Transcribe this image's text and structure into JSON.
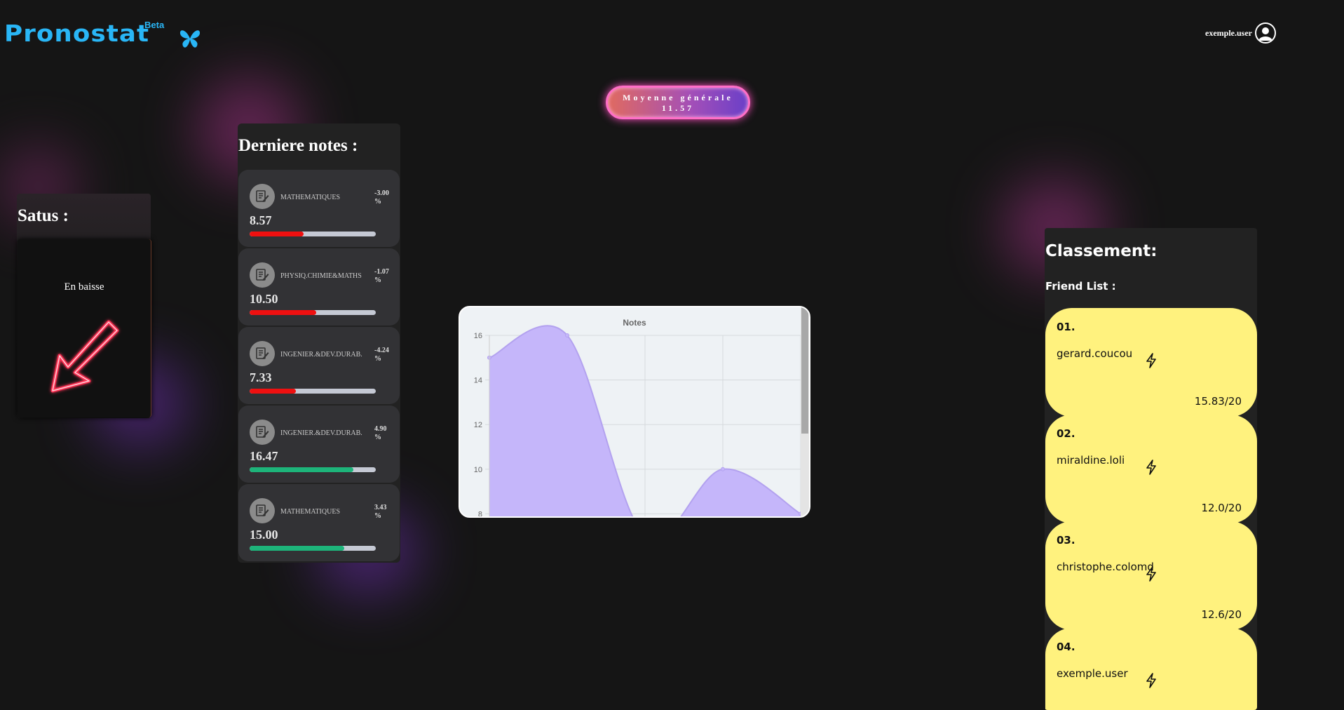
{
  "header": {
    "logo_text": "Pronostat",
    "logo_badge": "Beta",
    "username": "exemple.user"
  },
  "average": {
    "label": "Moyenne générale",
    "value": "11.57"
  },
  "status": {
    "title": "Satus :",
    "label": "En baisse"
  },
  "notes": {
    "title": "Derniere notes :",
    "items": [
      {
        "subject": "MATHEMATIQUES",
        "change": "-3.00",
        "unit": "%",
        "value": "8.57",
        "fill": 0.4285,
        "color": "#ef1010"
      },
      {
        "subject": "PHYSIQ.CHIMIE&MATHS",
        "change": "-1.07",
        "unit": "%",
        "value": "10.50",
        "fill": 0.525,
        "color": "#ef1010"
      },
      {
        "subject": "INGENIER.&DEV.DURAB.",
        "change": "-4.24",
        "unit": "%",
        "value": "7.33",
        "fill": 0.3665,
        "color": "#ef1010"
      },
      {
        "subject": "INGENIER.&DEV.DURAB.",
        "change": "4.90",
        "unit": "%",
        "value": "16.47",
        "fill": 0.8235,
        "color": "#1db47a"
      },
      {
        "subject": "MATHEMATIQUES",
        "change": "3.43",
        "unit": "%",
        "value": "15.00",
        "fill": 0.75,
        "color": "#1db47a"
      }
    ]
  },
  "chart_data": {
    "type": "area",
    "title": "Notes",
    "xlabel": "",
    "ylabel": "",
    "y_ticks": [
      "16",
      "14",
      "12",
      "10",
      "8"
    ],
    "ylim": [
      6,
      16
    ],
    "series": [
      {
        "values": [
          15.0,
          16.0,
          7.0,
          10.0,
          8.0
        ]
      }
    ],
    "grid": true,
    "fill_color": "#c5b6fa",
    "line_color": "#b3a2ef"
  },
  "ranking": {
    "title": "Classement:",
    "subtitle": "Friend List :",
    "friends": [
      {
        "rank": "01.",
        "name": "gerard.coucou",
        "score": "15.83/20"
      },
      {
        "rank": "02.",
        "name": "miraldine.loli",
        "score": "12.0/20"
      },
      {
        "rank": "03.",
        "name": "christophe.colomd",
        "score": "12.6/20"
      },
      {
        "rank": "04.",
        "name": "exemple.user",
        "score": ""
      }
    ]
  },
  "icons": {
    "logo": "butterfly-icon",
    "user": "user-avatar-icon",
    "note": "document-edit-icon",
    "status": "arrow-down-left-icon",
    "friend": "lightning-bolt-icon"
  }
}
